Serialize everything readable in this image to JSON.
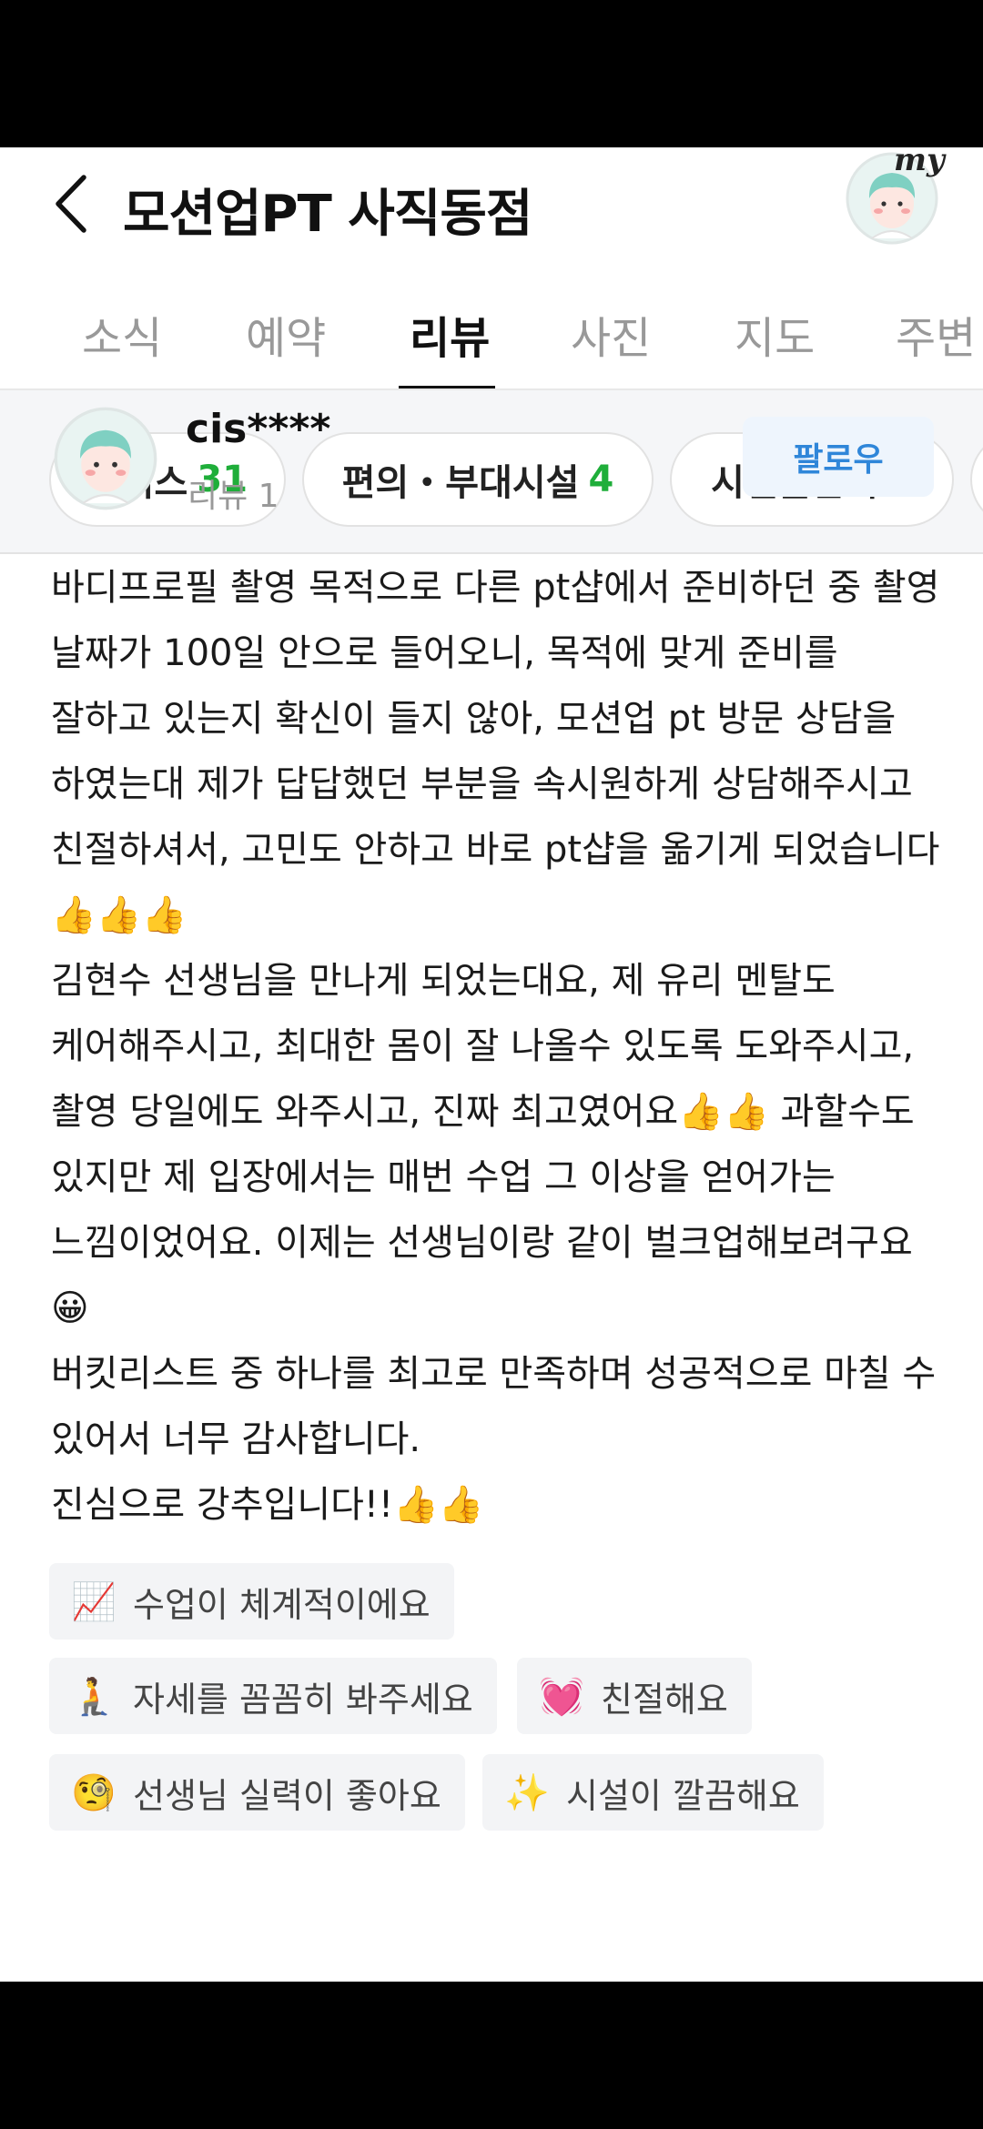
{
  "header": {
    "title": "모션업PT 사직동점",
    "my_label": "my"
  },
  "tabs": [
    {
      "label": "소식"
    },
    {
      "label": "예약"
    },
    {
      "label": "리뷰"
    },
    {
      "label": "사진"
    },
    {
      "label": "지도"
    },
    {
      "label": "주변"
    }
  ],
  "filters": [
    {
      "label": "서비스",
      "count": "31"
    },
    {
      "label": "편의・부대시설",
      "count": "4"
    },
    {
      "label": "시설물관리",
      "count": "3"
    }
  ],
  "reviewer": {
    "name": "cis****",
    "review_count": "리뷰 1",
    "follow_label": "팔로우"
  },
  "review": {
    "p1": "바디프로필 촬영 목적으로 다른 pt샵에서 준비하던 중 촬영 날짜가 100일 안으로 들어오니, 목적에 맞게 준비를 잘하고 있는지 확신이 들지 않아, 모션업 pt 방문 상담을 하였는대 제가 답답했던 부분을 속시원하게 상담해주시고 친절하셔서, 고민도 안하고 바로 pt샵을 옮기게 되었습니다",
    "e1": "👍👍👍",
    "p2a": "김현수 선생님을 만나게 되었는대요, 제 유리 멘탈도 케어해주시고, 최대한 몸이 잘 나올수 있도록 도와주시고, 촬영 당일에도 와주시고, 진짜 최고였어요",
    "e2": "👍👍",
    "p2b": " 과할수도 있지만 제 입장에서는 매번 수업 그 이상을 얻어가는 느낌이었어요. 이제는 선생님이랑 같이 벌크업해보려구요",
    "e3": "😀",
    "p3": "버킷리스트 중 하나를 최고로 만족하며 성공적으로 마칠 수 있어서 너무 감사합니다.",
    "p4": "진심으로 강추입니다!!",
    "e4": "👍👍"
  },
  "tags": [
    {
      "emoji": "📈",
      "label": "수업이 체계적이에요"
    },
    {
      "emoji": "🧎",
      "label": "자세를 꼼꼼히 봐주세요"
    },
    {
      "emoji": "💓",
      "label": "친절해요"
    },
    {
      "emoji": "🧐",
      "label": "선생님 실력이 좋아요"
    },
    {
      "emoji": "✨",
      "label": "시설이 깔끔해요"
    }
  ],
  "colors": {
    "count_green": "#1fae3a",
    "follow_blue": "#2f86d9",
    "avatar_hair": "#7fd0c2"
  }
}
